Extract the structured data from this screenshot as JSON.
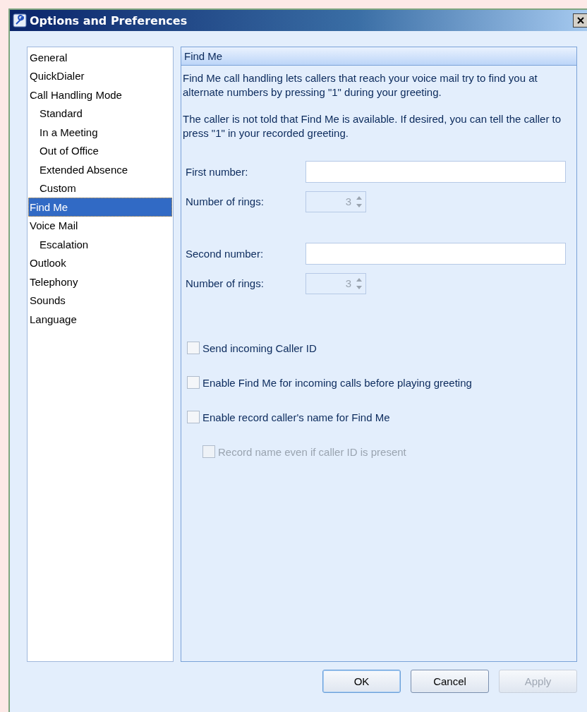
{
  "window": {
    "title": "Options and Preferences"
  },
  "sidebar": {
    "items": [
      {
        "label": "General",
        "selected": false
      },
      {
        "label": "QuickDialer",
        "selected": false
      },
      {
        "label": "Call Handling Mode",
        "selected": false,
        "children": [
          {
            "label": "Standard",
            "selected": false
          },
          {
            "label": "In a Meeting",
            "selected": false
          },
          {
            "label": "Out of Office",
            "selected": false
          },
          {
            "label": "Extended Absence",
            "selected": false
          },
          {
            "label": "Custom",
            "selected": false
          }
        ]
      },
      {
        "label": "Find Me",
        "selected": true
      },
      {
        "label": "Voice Mail",
        "selected": false,
        "children": [
          {
            "label": "Escalation",
            "selected": false
          }
        ]
      },
      {
        "label": "Outlook",
        "selected": false
      },
      {
        "label": "Telephony",
        "selected": false
      },
      {
        "label": "Sounds",
        "selected": false
      },
      {
        "label": "Language",
        "selected": false
      }
    ]
  },
  "panel": {
    "title": "Find Me",
    "paragraphs": [
      "Find Me call handling lets callers that reach your voice mail try to find you at alternate numbers by pressing \"1\" during your greeting.",
      "The caller is not told that Find Me is available. If desired, you can tell the caller to press \"1\" in your recorded greeting."
    ],
    "numbers": [
      {
        "label": "First number:",
        "rings_label": "Number of rings:",
        "rings": "3",
        "rings_disabled": true
      },
      {
        "label": "Second number:",
        "rings_label": "Number of rings:",
        "rings": "3",
        "rings_disabled": true
      }
    ],
    "checkboxes": [
      {
        "label": "Send incoming Caller ID",
        "checked": false,
        "disabled": false
      },
      {
        "label": "Enable Find Me for incoming calls before playing greeting",
        "checked": false,
        "disabled": false
      },
      {
        "label": "Enable record caller's name for Find Me",
        "checked": false,
        "disabled": false,
        "children": [
          {
            "label": "Record name even if caller ID is present",
            "checked": false,
            "disabled": true
          }
        ]
      }
    ]
  },
  "buttons": [
    {
      "label": "OK",
      "default": true,
      "disabled": false
    },
    {
      "label": "Cancel",
      "default": false,
      "disabled": false
    },
    {
      "label": "Apply",
      "default": false,
      "disabled": true
    }
  ]
}
